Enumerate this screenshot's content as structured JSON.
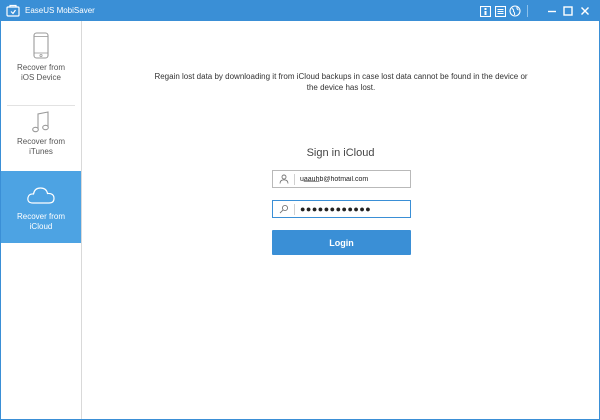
{
  "app": {
    "title": "EaseUS MobiSaver"
  },
  "titlebar": {
    "icons": [
      "app-logo-icon",
      "register-icon",
      "menu-icon",
      "globe-icon",
      "minimize-icon",
      "maximize-icon",
      "close-icon"
    ]
  },
  "sidebar": {
    "items": [
      {
        "label_line1": "Recover from",
        "label_line2": "iOS Device",
        "icon": "phone-icon",
        "active": false
      },
      {
        "label_line1": "Recover from",
        "label_line2": "iTunes",
        "icon": "music-note-icon",
        "active": false
      },
      {
        "label_line1": "Recover from",
        "label_line2": "iCloud",
        "icon": "cloud-icon",
        "active": true
      }
    ]
  },
  "main": {
    "description": "Regain lost data by downloading it from iCloud backups in case lost data cannot be found in the device or the device has lost.",
    "signin_title": "Sign in iCloud",
    "email_value": "ua̲a̲u̲h̲b@hotmail.com",
    "password_value": "●●●●●●●●●●●●",
    "login_label": "Login"
  },
  "colors": {
    "accent": "#3a8fd6",
    "active_sidebar": "#4da3e3"
  }
}
